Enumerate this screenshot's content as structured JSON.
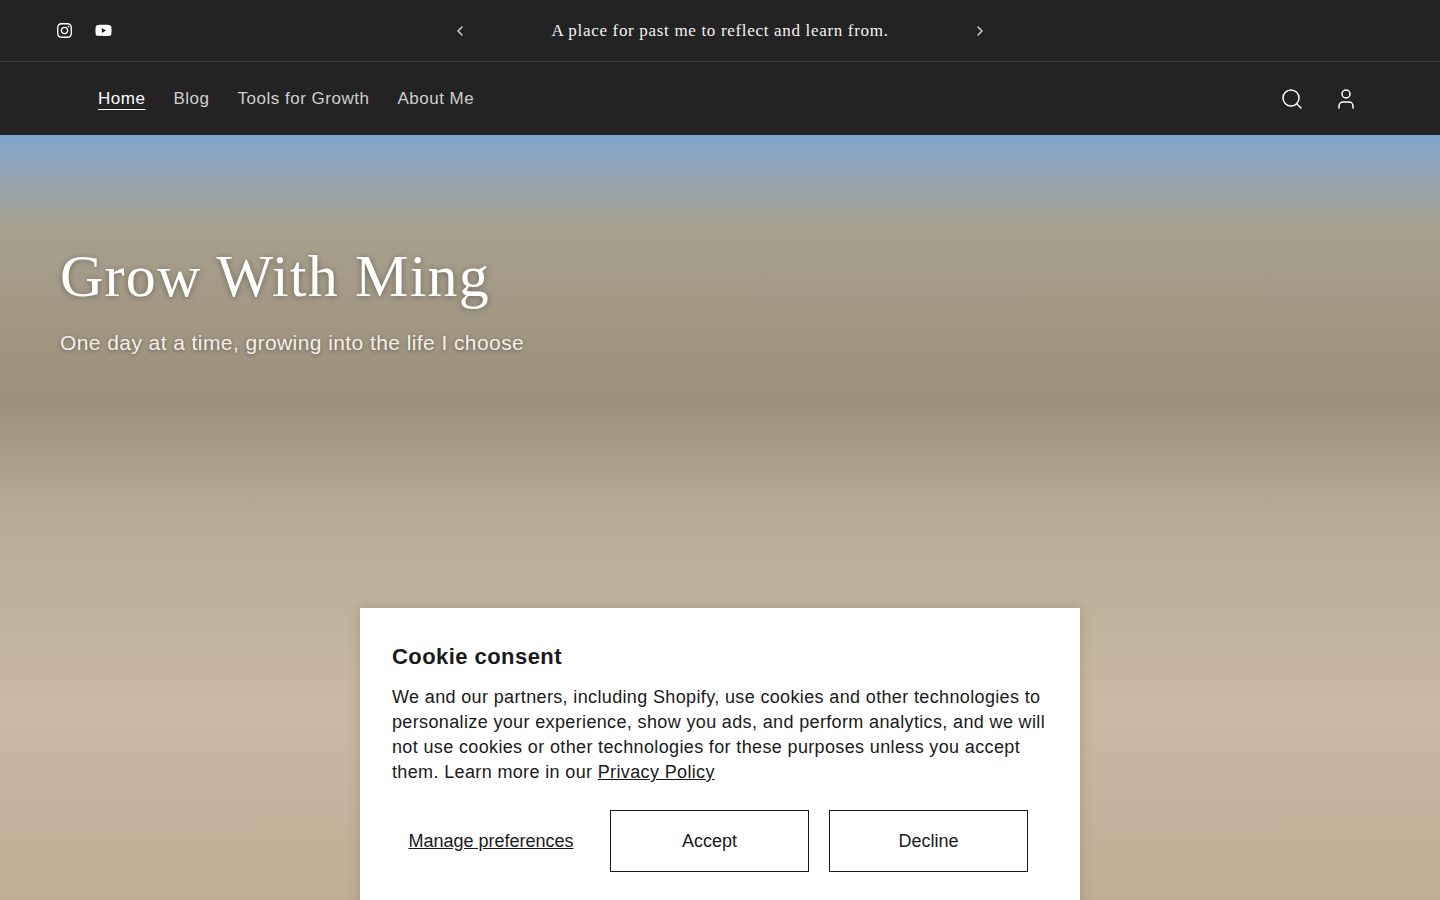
{
  "announcement": {
    "text": "A place for past me to reflect and learn from."
  },
  "nav": {
    "items": [
      {
        "label": "Home",
        "selected": true
      },
      {
        "label": "Blog",
        "selected": false
      },
      {
        "label": "Tools for Growth",
        "selected": false
      },
      {
        "label": "About Me",
        "selected": false
      }
    ]
  },
  "hero": {
    "title": "Grow With Ming",
    "subtitle": "One day at a time, growing into the life I choose"
  },
  "cookie": {
    "title": "Cookie consent",
    "body": "We and our partners, including Shopify, use cookies and other technologies to personalize your experience, show you ads, and perform analytics, and we will not use cookies or other technologies for these purposes unless you accept them. Learn more in our",
    "link": "Privacy Policy",
    "manage": "Manage preferences",
    "buttons": [
      "Accept",
      "Decline"
    ]
  }
}
